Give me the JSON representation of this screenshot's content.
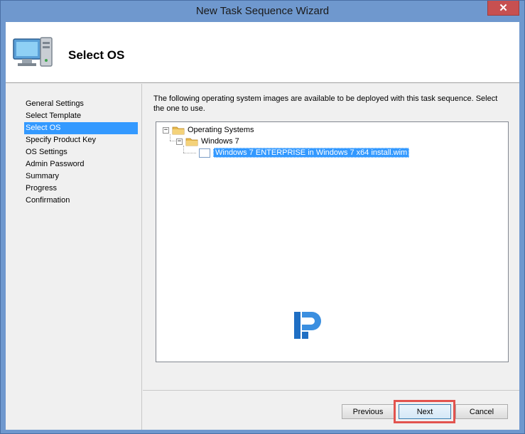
{
  "window": {
    "title": "New Task Sequence Wizard",
    "close_glyph": "✕"
  },
  "header": {
    "title": "Select OS",
    "icon": "computer-icon"
  },
  "nav": {
    "items": [
      {
        "label": "General Settings",
        "selected": false
      },
      {
        "label": "Select Template",
        "selected": false
      },
      {
        "label": "Select OS",
        "selected": true
      },
      {
        "label": "Specify Product Key",
        "selected": false
      },
      {
        "label": "OS Settings",
        "selected": false
      },
      {
        "label": "Admin Password",
        "selected": false
      },
      {
        "label": "Summary",
        "selected": false
      },
      {
        "label": "Progress",
        "selected": false
      },
      {
        "label": "Confirmation",
        "selected": false
      }
    ]
  },
  "content": {
    "instructions": "The following operating system images are available to be deployed with this task sequence.  Select the one to use.",
    "tree": {
      "root": {
        "label": "Operating Systems",
        "expander": "−"
      },
      "child": {
        "label": "Windows 7",
        "expander": "−"
      },
      "leaf": {
        "label": "Windows 7 ENTERPRISE in Windows 7 x64 install.wim",
        "selected": true
      }
    }
  },
  "buttons": {
    "previous": "Previous",
    "next": "Next",
    "cancel": "Cancel"
  },
  "colors": {
    "selection": "#3399ff",
    "titlebar": "#6f98ce",
    "close": "#c75050",
    "highlight": "#e2534e"
  }
}
